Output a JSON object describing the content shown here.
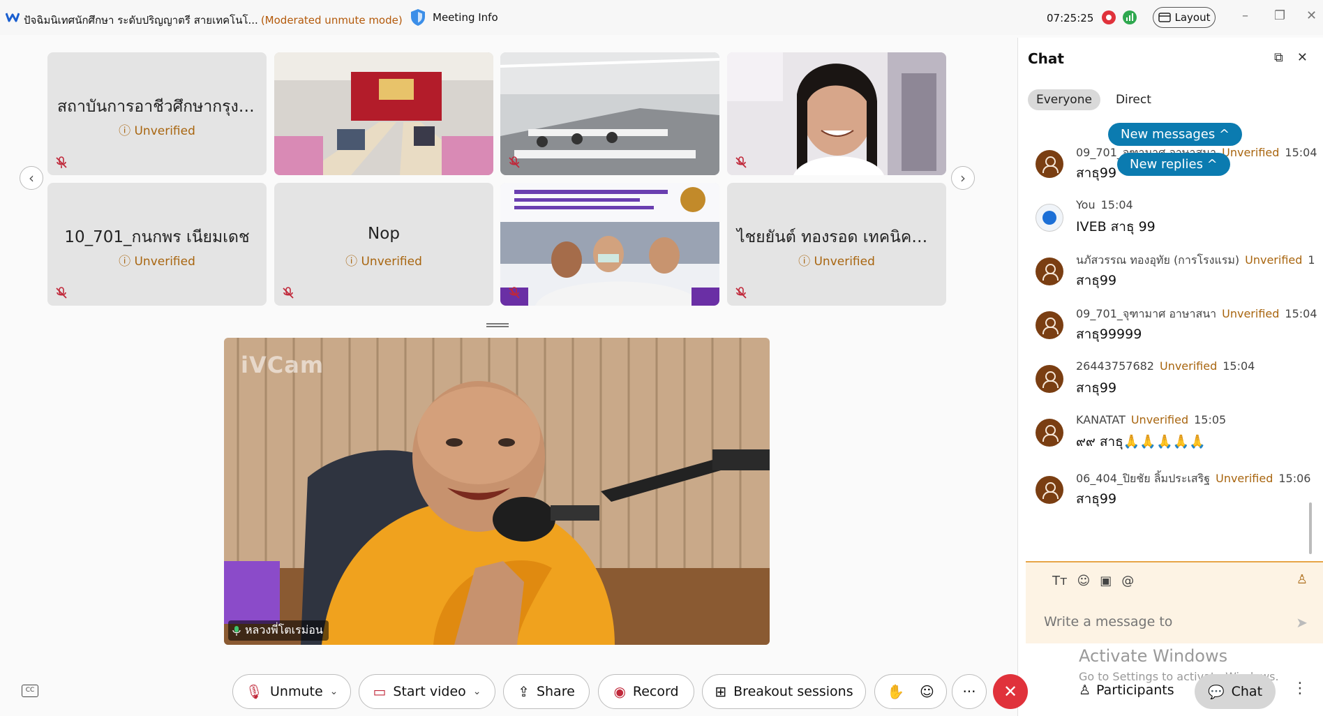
{
  "window": {
    "title": "ปัจฉิมนิเทศนักศึกษา ระดับปริญญาตรี สายเทคโนโ...",
    "mode": "(Moderated unmute mode)",
    "meeting_info": "Meeting Info",
    "clock": "07:25:25",
    "layout_label": "Layout",
    "minimize": "–",
    "restore": "❐",
    "close": "✕"
  },
  "grid": {
    "tiles": [
      {
        "name": "สถาบันการอาชีวศึกษากรุงเท...",
        "status": "Unverified"
      },
      {
        "name": "",
        "status": ""
      },
      {
        "name": "",
        "status": ""
      },
      {
        "name": "",
        "status": ""
      },
      {
        "name": "10_701_กนกพร เนียมเดช",
        "status": "Unverified"
      },
      {
        "name": "Nop",
        "status": "Unverified"
      },
      {
        "name": "",
        "status": ""
      },
      {
        "name": "ไชยยันต์ ทองรอด เทคนิคดอ...",
        "status": "Unverified"
      }
    ],
    "prev_arrow": "‹",
    "next_arrow": "›"
  },
  "main_video": {
    "watermark": "iVCam",
    "speaker": "หลวงพี่โตเรม่อน"
  },
  "chat": {
    "title": "Chat",
    "tabs": [
      "Everyone",
      "Direct"
    ],
    "new_messages": "New messages ^",
    "new_replies": "New replies ^",
    "messages": [
      {
        "sender": "09_701_จุฑามาศ อาษาสนา",
        "status": "Unverified",
        "time": "15:04",
        "text": "สาธุ99"
      },
      {
        "sender": "You",
        "status": "",
        "time": "15:04",
        "text": "IVEB สาธุ 99"
      },
      {
        "sender": "นภัสวรรณ ทองอุทัย (การโรงแรม)",
        "status": "Unverified",
        "time": "1",
        "text": "สาธุ99"
      },
      {
        "sender": "09_701_จุฑามาศ อาษาสนา",
        "status": "Unverified",
        "time": "15:04",
        "text": "สาธุ99999"
      },
      {
        "sender": "26443757682",
        "status": "Unverified",
        "time": "15:04",
        "text": "สาธุ99"
      },
      {
        "sender": "KANATAT",
        "status": "Unverified",
        "time": "15:05",
        "text": "๙๙ สาธุ🙏🙏🙏🙏🙏"
      },
      {
        "sender": "06_404_ปิยชัย ลิ้มประเสริฐ",
        "status": "Unverified",
        "time": "15:06",
        "text": "สาธุ99"
      }
    ],
    "composer_placeholder": "Write a message to"
  },
  "activate_windows": {
    "line1": "Activate Windows",
    "line2": "Go to Settings to activate Windows."
  },
  "toolbar": {
    "unmute": "Unmute",
    "start_video": "Start video",
    "share": "Share",
    "record": "Record",
    "breakout": "Breakout sessions",
    "more": "···",
    "participants": "Participants",
    "chat": "Chat",
    "more_right": "⋮"
  },
  "colors": {
    "unverified": "#a8650f",
    "accent_blue": "#0b7bb0",
    "end_red": "#e0323b"
  }
}
